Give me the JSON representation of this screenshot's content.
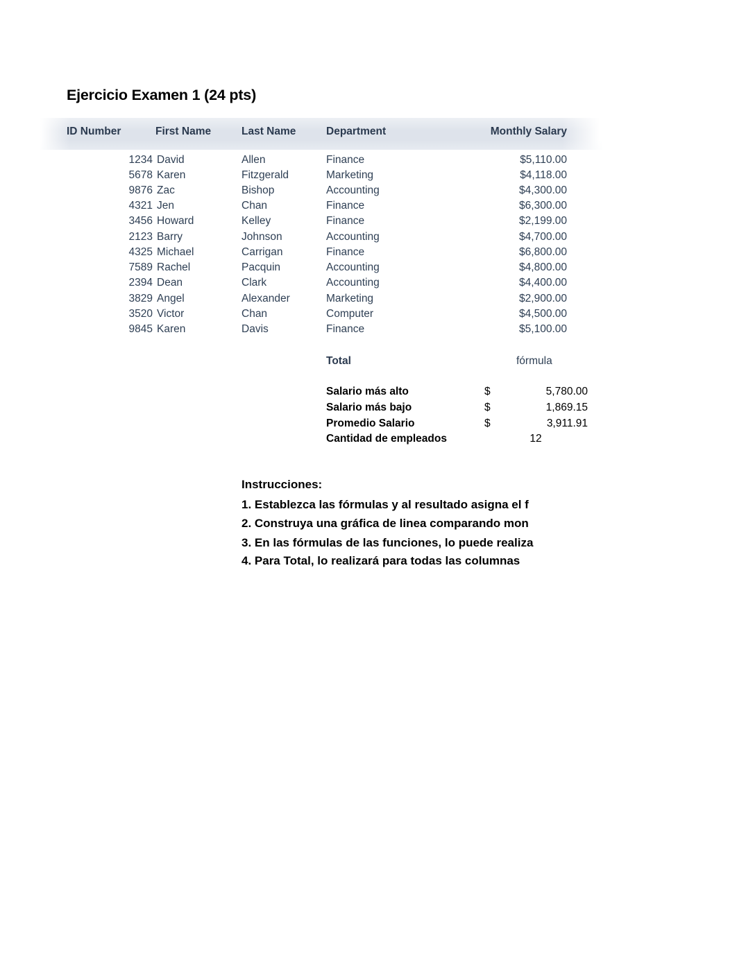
{
  "document": {
    "title": "Ejercicio Examen 1 (24 pts)"
  },
  "table": {
    "headers": {
      "id": "ID Number",
      "first": "First Name",
      "last": "Last Name",
      "dept": "Department",
      "salary": "Monthly Salary"
    },
    "rows": [
      {
        "id": "1234",
        "first": "David",
        "last": "Allen",
        "dept": "Finance",
        "salary": "$5,110.00"
      },
      {
        "id": "5678",
        "first": "Karen",
        "last": "Fitzgerald",
        "dept": "Marketing",
        "salary": "$4,118.00"
      },
      {
        "id": "9876",
        "first": "Zac",
        "last": "Bishop",
        "dept": "Accounting",
        "salary": "$4,300.00"
      },
      {
        "id": "4321",
        "first": "Jen",
        "last": "Chan",
        "dept": "Finance",
        "salary": "$6,300.00"
      },
      {
        "id": "3456",
        "first": "Howard",
        "last": "Kelley",
        "dept": "Finance",
        "salary": "$2,199.00"
      },
      {
        "id": "2123",
        "first": "Barry",
        "last": "Johnson",
        "dept": "Accounting",
        "salary": "$4,700.00"
      },
      {
        "id": "4325",
        "first": "Michael",
        "last": "Carrigan",
        "dept": "Finance",
        "salary": "$6,800.00"
      },
      {
        "id": "7589",
        "first": "Rachel",
        "last": "Pacquin",
        "dept": "Accounting",
        "salary": "$4,800.00"
      },
      {
        "id": "2394",
        "first": "Dean",
        "last": "Clark",
        "dept": "Accounting",
        "salary": "$4,400.00"
      },
      {
        "id": "3829",
        "first": "Angel",
        "last": "Alexander",
        "dept": "Marketing",
        "salary": "$2,900.00"
      },
      {
        "id": "3520",
        "first": "Victor",
        "last": "Chan",
        "dept": "Computer",
        "salary": "$4,500.00"
      },
      {
        "id": "9845",
        "first": "Karen",
        "last": "Davis",
        "dept": "Finance",
        "salary": "$5,100.00"
      }
    ]
  },
  "summary": {
    "total_label": "Total",
    "total_value": "fórmula",
    "highest_label": "Salario más alto",
    "highest_currency": "$",
    "highest_value": "5,780.00",
    "lowest_label": "Salario más bajo",
    "lowest_currency": "$",
    "lowest_value": "1,869.15",
    "average_label": "Promedio Salario",
    "average_currency": "$",
    "average_value": "3,911.91",
    "count_label": "Cantidad de empleados",
    "count_value": "12"
  },
  "instructions": {
    "title": "Instrucciones:",
    "items": [
      "1. Establezca las fórmulas y al resultado asigna el f",
      "2. Construya una gráfica de linea comparando mon",
      "3. En las fórmulas de las funciones, lo puede realiza",
      "4. Para Total, lo realizará para todas las columnas"
    ]
  },
  "colors": {
    "header_band": "#dee3eb",
    "header_text": "#2b3a4f",
    "body_text": "#2e3f54",
    "title_text": "#000000",
    "page_background": "#ffffff"
  }
}
